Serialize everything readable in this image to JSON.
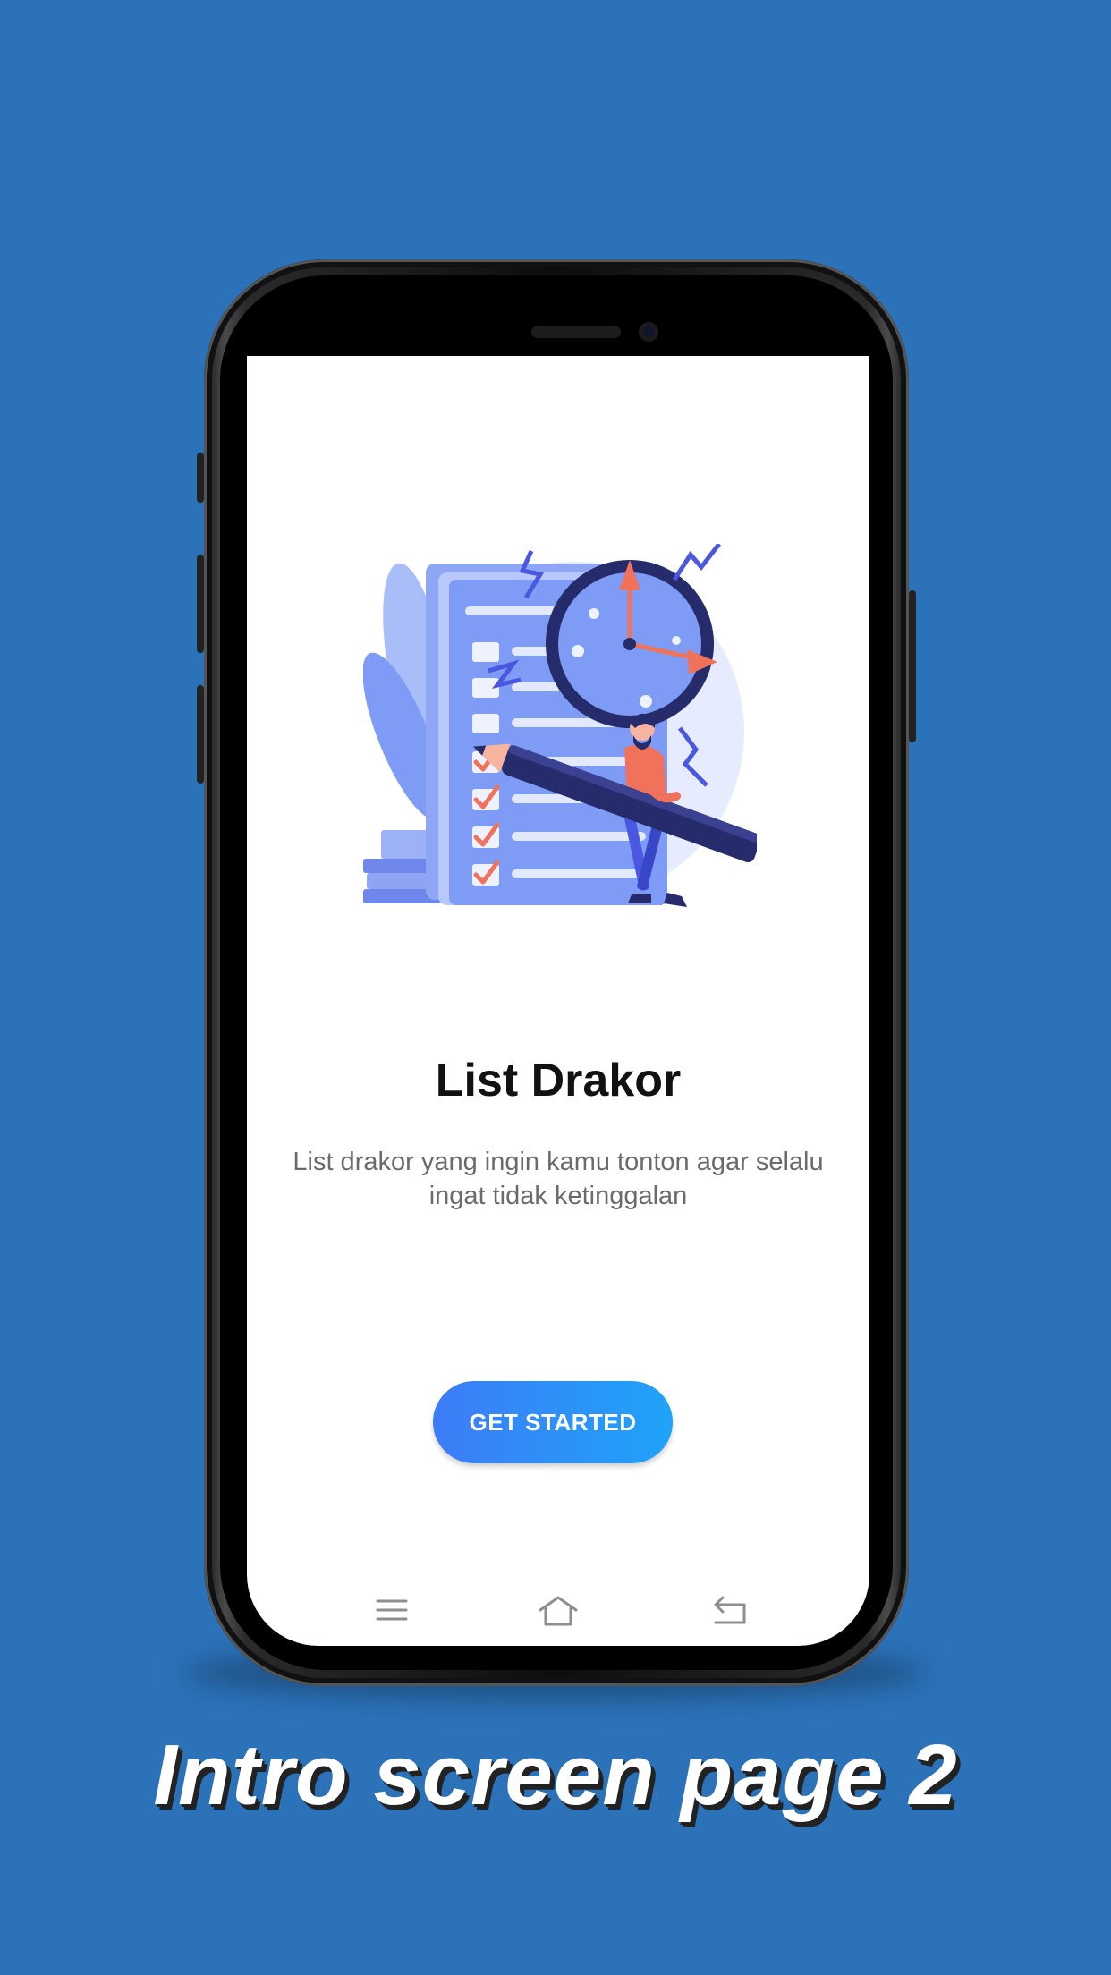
{
  "screen": {
    "title": "List Drakor",
    "description": "List drakor yang ingin kamu tonton agar selalu ingat tidak ketinggalan",
    "cta_label": "GET STARTED"
  },
  "nav_bar": {
    "icons": [
      "menu-icon",
      "home-icon",
      "back-icon"
    ]
  },
  "caption": "Intro screen page 2",
  "colors": {
    "background": "#2b72b9",
    "cta_start": "#3d7cf7",
    "cta_end": "#1fa3f8",
    "illustration_primary": "#7e9cf5",
    "illustration_accent": "#f0725a",
    "illustration_dark": "#252b6b"
  }
}
